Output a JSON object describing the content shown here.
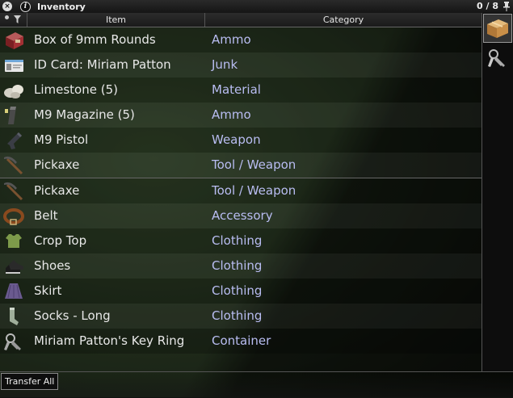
{
  "window": {
    "title": "Inventory",
    "count": "0 / 8",
    "close_glyph": "×",
    "info_glyph": "i"
  },
  "columns": {
    "item": "Item",
    "category": "Category"
  },
  "items": [
    {
      "name": "Box of 9mm Rounds",
      "category": "Ammo",
      "icon": "ammo-box-icon"
    },
    {
      "name": "ID Card: Miriam Patton",
      "category": "Junk",
      "icon": "id-card-icon"
    },
    {
      "name": "Limestone (5)",
      "category": "Material",
      "icon": "limestone-icon"
    },
    {
      "name": "M9 Magazine (5)",
      "category": "Ammo",
      "icon": "magazine-icon"
    },
    {
      "name": "M9 Pistol",
      "category": "Weapon",
      "icon": "pistol-icon"
    },
    {
      "name": "Pickaxe",
      "category": "Tool / Weapon",
      "icon": "pickaxe-icon"
    },
    {
      "name": "Pickaxe",
      "category": "Tool / Weapon",
      "icon": "pickaxe-icon"
    },
    {
      "name": "Belt",
      "category": "Accessory",
      "icon": "belt-icon"
    },
    {
      "name": "Crop Top",
      "category": "Clothing",
      "icon": "crop-top-icon"
    },
    {
      "name": "Shoes",
      "category": "Clothing",
      "icon": "shoes-icon"
    },
    {
      "name": "Skirt",
      "category": "Clothing",
      "icon": "skirt-icon"
    },
    {
      "name": "Socks - Long",
      "category": "Clothing",
      "icon": "socks-icon"
    },
    {
      "name": "Miriam Patton's Key Ring",
      "category": "Container",
      "icon": "key-ring-icon"
    }
  ],
  "bottom": {
    "transfer_all": "Transfer All"
  },
  "colors": {
    "category_text": "#b9bdf2",
    "item_text": "#e8e8e8"
  }
}
